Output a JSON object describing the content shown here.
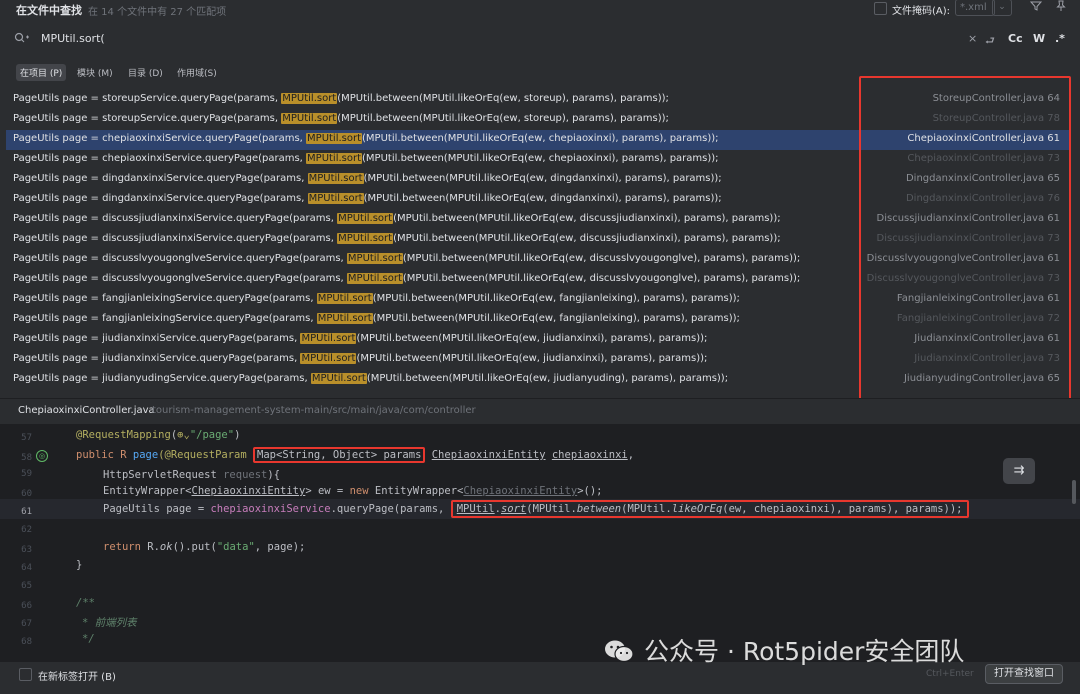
{
  "header": {
    "title": "在文件中查找",
    "subtitle": "在 14 个文件中有 27 个匹配项",
    "file_mask_label": "文件掩码(A):",
    "file_mask_value": "*.xml",
    "filter_icon": "funnel-icon",
    "pin_icon": "pin-icon"
  },
  "search": {
    "query": "MPUtil.sort(",
    "options": {
      "clear": "×",
      "replace": "⮐",
      "case": "Cc",
      "word": "W",
      "regex": ".*"
    }
  },
  "scopes": [
    {
      "label": "在项目 (P)",
      "active": true
    },
    {
      "label": "模块 (M)",
      "active": false
    },
    {
      "label": "目录 (D)",
      "active": false
    },
    {
      "label": "作用域(S)",
      "active": false
    }
  ],
  "results": [
    {
      "pre": "PageUtils page = storeupService.queryPage(params, ",
      "match": "MPUtil.sort",
      "post": "(MPUtil.between(MPUtil.likeOrEq(ew, storeup), params), params));",
      "file": "StoreupController.java 64",
      "dim": false
    },
    {
      "pre": "PageUtils page = storeupService.queryPage(params, ",
      "match": "MPUtil.sort",
      "post": "(MPUtil.between(MPUtil.likeOrEq(ew, storeup), params), params));",
      "file": "StoreupController.java 78",
      "dim": true
    },
    {
      "pre": "PageUtils page = chepiaoxinxiService.queryPage(params, ",
      "match": "MPUtil.sort",
      "post": "(MPUtil.between(MPUtil.likeOrEq(ew, chepiaoxinxi), params), params));",
      "file": "ChepiaoxinxiController.java 61",
      "dim": false,
      "selected": true
    },
    {
      "pre": "PageUtils page = chepiaoxinxiService.queryPage(params, ",
      "match": "MPUtil.sort",
      "post": "(MPUtil.between(MPUtil.likeOrEq(ew, chepiaoxinxi), params), params));",
      "file": "ChepiaoxinxiController.java 73",
      "dim": true
    },
    {
      "pre": "PageUtils page = dingdanxinxiService.queryPage(params, ",
      "match": "MPUtil.sort",
      "post": "(MPUtil.between(MPUtil.likeOrEq(ew, dingdanxinxi), params), params));",
      "file": "DingdanxinxiController.java 65",
      "dim": false
    },
    {
      "pre": "PageUtils page = dingdanxinxiService.queryPage(params, ",
      "match": "MPUtil.sort",
      "post": "(MPUtil.between(MPUtil.likeOrEq(ew, dingdanxinxi), params), params));",
      "file": "DingdanxinxiController.java 76",
      "dim": true
    },
    {
      "pre": "PageUtils page = discussjiudianxinxiService.queryPage(params, ",
      "match": "MPUtil.sort",
      "post": "(MPUtil.between(MPUtil.likeOrEq(ew, discussjiudianxinxi), params), params));",
      "file": "DiscussjiudianxinxiController.java 61",
      "dim": false
    },
    {
      "pre": "PageUtils page = discussjiudianxinxiService.queryPage(params, ",
      "match": "MPUtil.sort",
      "post": "(MPUtil.between(MPUtil.likeOrEq(ew, discussjiudianxinxi), params), params));",
      "file": "DiscussjiudianxinxiController.java 73",
      "dim": true
    },
    {
      "pre": "PageUtils page = discusslvyougonglveService.queryPage(params, ",
      "match": "MPUtil.sort",
      "post": "(MPUtil.between(MPUtil.likeOrEq(ew, discusslvyougonglve), params), params));",
      "file": "DiscusslvyougonglveController.java 61",
      "dim": false
    },
    {
      "pre": "PageUtils page = discusslvyougonglveService.queryPage(params, ",
      "match": "MPUtil.sort",
      "post": "(MPUtil.between(MPUtil.likeOrEq(ew, discusslvyougonglve), params), params));",
      "file": "DiscusslvyougonglveController.java 73",
      "dim": true
    },
    {
      "pre": "PageUtils page = fangjianleixingService.queryPage(params, ",
      "match": "MPUtil.sort",
      "post": "(MPUtil.between(MPUtil.likeOrEq(ew, fangjianleixing), params), params));",
      "file": "FangjianleixingController.java 61",
      "dim": false
    },
    {
      "pre": "PageUtils page = fangjianleixingService.queryPage(params, ",
      "match": "MPUtil.sort",
      "post": "(MPUtil.between(MPUtil.likeOrEq(ew, fangjianleixing), params), params));",
      "file": "FangjianleixingController.java 72",
      "dim": true
    },
    {
      "pre": "PageUtils page = jiudianxinxiService.queryPage(params, ",
      "match": "MPUtil.sort",
      "post": "(MPUtil.between(MPUtil.likeOrEq(ew, jiudianxinxi), params), params));",
      "file": "JiudianxinxiController.java 61",
      "dim": false
    },
    {
      "pre": "PageUtils page = jiudianxinxiService.queryPage(params, ",
      "match": "MPUtil.sort",
      "post": "(MPUtil.between(MPUtil.likeOrEq(ew, jiudianxinxi), params), params));",
      "file": "JiudianxinxiController.java 73",
      "dim": true
    },
    {
      "pre": "PageUtils page = jiudianyudingService.queryPage(params, ",
      "match": "MPUtil.sort",
      "post": "(MPUtil.between(MPUtil.likeOrEq(ew, jiudianyuding), params), params));",
      "file": "JiudianyudingController.java 65",
      "dim": false
    }
  ],
  "preview": {
    "file": "ChepiaoxinxiController.java",
    "path": "tourism-management-system-main/src/main/java/com/controller",
    "line_numbers": [
      "57",
      "58",
      "59",
      "60",
      "61",
      "62",
      "63",
      "64",
      "65",
      "66",
      "67",
      "68"
    ],
    "current_line": "61",
    "mapping_path": "\"/page\"",
    "line58_public": "public R ",
    "line58_page": "page",
    "line58_annot": "(@RequestParam ",
    "line58_map": "Map<String, Object> params",
    "line58_entity": "ChepiaoxinxiEntity",
    "line58_var": "chepiaoxinxi",
    "line59": "HttpServletRequest ",
    "line59_req": "request",
    "line59_end": "){",
    "line60_a": "EntityWrapper<",
    "line60_b": "ChepiaoxinxiEntity",
    "line60_c": "> ew = ",
    "line60_new": "new ",
    "line60_d": "EntityWrapper<",
    "line60_e": "ChepiaoxinxiEntity",
    "line60_f": ">();",
    "line61_a": "PageUtils page = ",
    "line61_svc": "chepiaoxinxiService",
    "line61_b": ".queryPage(params, ",
    "line61_mp": "MPUtil",
    "line61_sort": "sort",
    "line61_c": "(",
    "line61_mp2": "MPUtil",
    "line61_between": "between",
    "line61_mp3": "MPUtil",
    "line61_like": "likeOrEq",
    "line61_d": "(ew, chepiaoxinxi), params), params));",
    "line63_ret": "return ",
    "line63_a": "R.",
    "line63_ok": "ok",
    "line63_b": "().put(",
    "line63_str": "\"data\"",
    "line63_c": ", page);",
    "line64": "}",
    "line66": "/**",
    "line67": "* 前端列表",
    "line68": "*/",
    "request_mapping": "@RequestMapping"
  },
  "footer": {
    "new_tab_label": "在新标签打开 (B)",
    "shortcut": "Ctrl+Enter",
    "open_button": "打开查找窗口"
  },
  "watermark": "公众号 · Rot5pider安全团队"
}
